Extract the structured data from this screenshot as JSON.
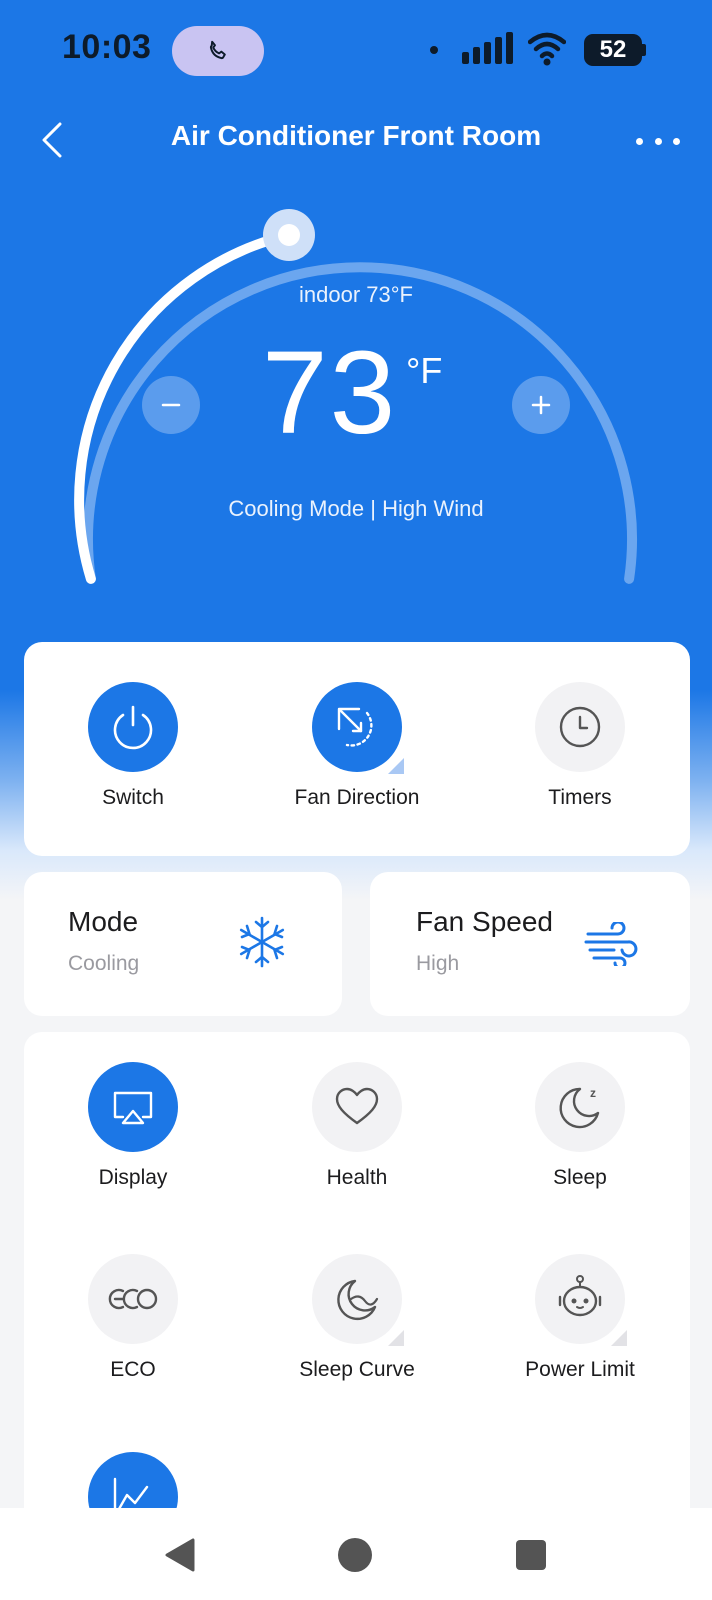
{
  "status_bar": {
    "time": "10:03",
    "battery": "52",
    "icons": [
      "phone-call-icon",
      "notification-dot-icon",
      "signal-icon",
      "wifi-icon",
      "battery-icon"
    ]
  },
  "header": {
    "title": "Air Conditioner Front Room",
    "back_icon": "chevron-left-icon",
    "more_icon": "more-dots-icon"
  },
  "thermostat": {
    "indoor_label": "indoor  73°F",
    "set_temperature": "73",
    "unit": "°F",
    "mode_summary": "Cooling Mode | High Wind",
    "minus_icon": "minus-icon",
    "plus_icon": "plus-icon"
  },
  "quick_actions": [
    {
      "label": "Switch",
      "icon": "power-icon",
      "active": true
    },
    {
      "label": "Fan Direction",
      "icon": "fan-direction-icon",
      "active": true
    },
    {
      "label": "Timers",
      "icon": "clock-icon",
      "active": false
    }
  ],
  "mode_card": {
    "title": "Mode",
    "value": "Cooling",
    "icon": "snowflake-icon"
  },
  "fan_card": {
    "title": "Fan Speed",
    "value": "High",
    "icon": "wind-icon"
  },
  "features": [
    {
      "label": "Display",
      "icon": "display-icon",
      "active": true
    },
    {
      "label": "Health",
      "icon": "heart-icon",
      "active": false
    },
    {
      "label": "Sleep",
      "icon": "sleep-moon-icon",
      "active": false
    },
    {
      "label": "ECO",
      "icon": "eco-icon",
      "active": false
    },
    {
      "label": "Sleep Curve",
      "icon": "sleep-curve-icon",
      "active": false
    },
    {
      "label": "Power Limit",
      "icon": "robot-icon",
      "active": false
    },
    {
      "label": "",
      "icon": "chart-line-icon",
      "active": true
    }
  ],
  "colors": {
    "primary": "#1c77e6",
    "background": "#f4f5f7",
    "card": "#ffffff",
    "inactive_circle": "#f2f2f4"
  },
  "nav_bar": {
    "icons": [
      "nav-back-icon",
      "nav-home-icon",
      "nav-recents-icon"
    ]
  }
}
